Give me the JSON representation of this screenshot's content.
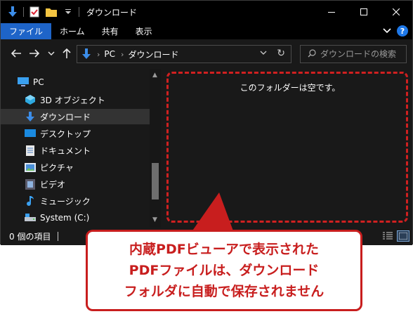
{
  "window": {
    "title": "ダウンロード",
    "accent": "#1e64c8"
  },
  "ribbon": {
    "tabs": [
      {
        "label": "ファイル",
        "active": true
      },
      {
        "label": "ホーム",
        "active": false
      },
      {
        "label": "共有",
        "active": false
      },
      {
        "label": "表示",
        "active": false
      }
    ]
  },
  "address": {
    "crumbs": [
      "PC",
      "ダウンロード"
    ],
    "search_placeholder": "ダウンロードの検索"
  },
  "sidebar": {
    "items": [
      {
        "label": "PC",
        "icon": "pc-icon",
        "selected": false
      },
      {
        "label": "3D オブジェクト",
        "icon": "3d-objects-icon",
        "selected": false
      },
      {
        "label": "ダウンロード",
        "icon": "download-folder-icon",
        "selected": true
      },
      {
        "label": "デスクトップ",
        "icon": "desktop-icon",
        "selected": false
      },
      {
        "label": "ドキュメント",
        "icon": "documents-icon",
        "selected": false
      },
      {
        "label": "ピクチャ",
        "icon": "pictures-icon",
        "selected": false
      },
      {
        "label": "ビデオ",
        "icon": "videos-icon",
        "selected": false
      },
      {
        "label": "ミュージック",
        "icon": "music-icon",
        "selected": false
      },
      {
        "label": "System (C:)",
        "icon": "drive-icon",
        "selected": false
      }
    ]
  },
  "content": {
    "empty_message": "このフォルダーは空です。"
  },
  "status": {
    "item_count": "0 個の項目"
  },
  "callout": {
    "lines": [
      "内蔵PDFビューアで表示された",
      "PDFファイルは、ダウンロード",
      "フォルダに自動で保存されません"
    ],
    "color": "#c81e1e"
  }
}
